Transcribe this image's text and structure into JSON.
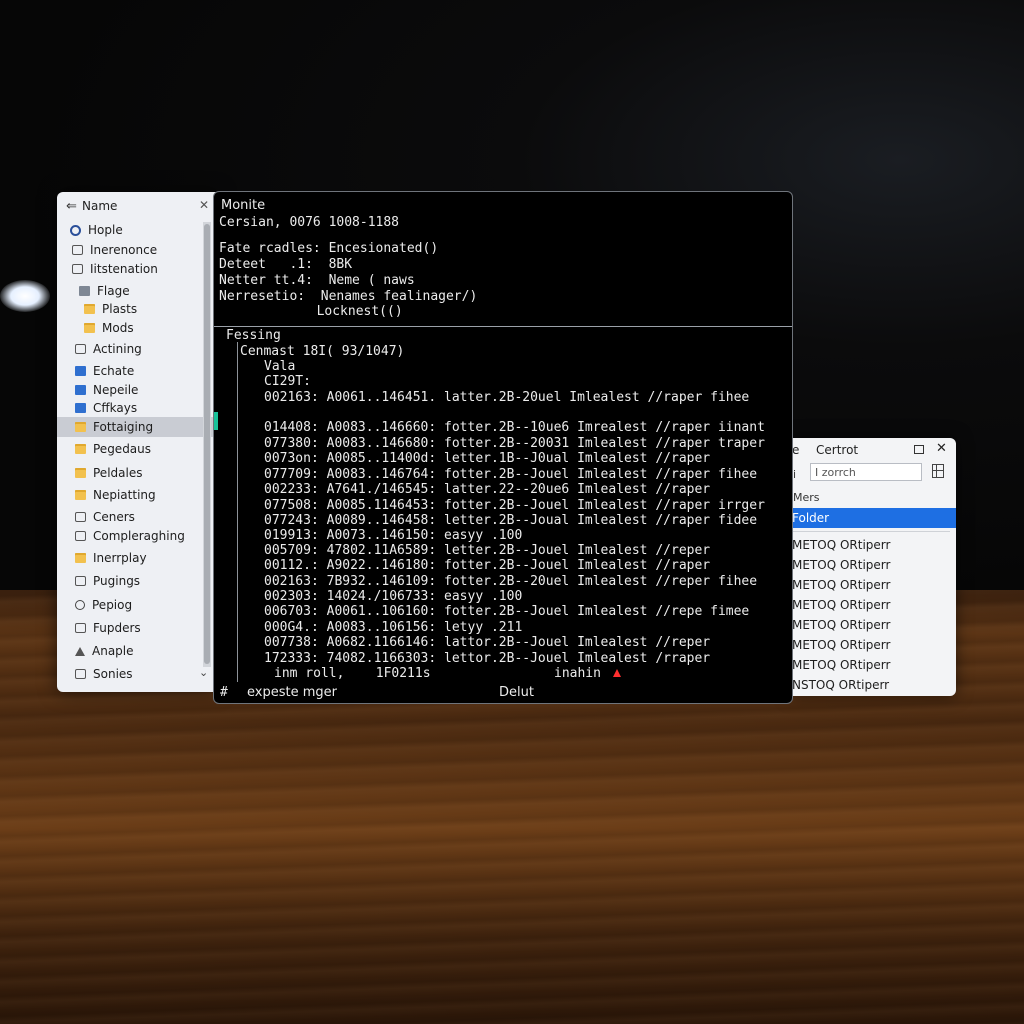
{
  "file_panel": {
    "header": "Name",
    "items": [
      {
        "label": "Hople",
        "icon": "search-icon"
      },
      {
        "label": "Inerenonce",
        "icon": "document-icon"
      },
      {
        "label": "Iitstenation",
        "icon": "document-icon"
      },
      {
        "label": "Flage",
        "icon": "document-icon"
      },
      {
        "label": "Plasts",
        "icon": "folder-icon"
      },
      {
        "label": "Mods",
        "icon": "folder-icon"
      },
      {
        "label": "Actining",
        "icon": "document-icon"
      },
      {
        "label": "Echate",
        "icon": "app-icon"
      },
      {
        "label": "Nepeile",
        "icon": "app-icon"
      },
      {
        "label": "Cffkays",
        "icon": "app-icon"
      },
      {
        "label": "Fottaiging",
        "icon": "folder-icon"
      },
      {
        "label": "Pegedaus",
        "icon": "folder-icon"
      },
      {
        "label": "Peldales",
        "icon": "folder-icon"
      },
      {
        "label": "Nepiatting",
        "icon": "folder-icon"
      },
      {
        "label": "Ceners",
        "icon": "document-icon"
      },
      {
        "label": "Compleraghing",
        "icon": "document-icon"
      },
      {
        "label": "Inerrplay",
        "icon": "folder-icon"
      },
      {
        "label": "Pugings",
        "icon": "document-icon"
      },
      {
        "label": "Pepiog",
        "icon": "disc-icon"
      },
      {
        "label": "Fupders",
        "icon": "document-icon"
      },
      {
        "label": "Anaple",
        "icon": "triangle-icon"
      },
      {
        "label": "Sonies",
        "icon": "document-icon"
      }
    ],
    "selected_index": 10
  },
  "terminal": {
    "title": "Monite",
    "version": "Cersian, 0076 1008-1188",
    "info": [
      "Fate rcadles: Encesionated()",
      "Deteet   .1:  8BK",
      "Netter tt.4:  Neme ( naws",
      "Nerresetio:  Nenames fealinager/)",
      "              Locknest(()"
    ],
    "section_label": "Fessing",
    "command_header": "Cenmast 18I( 93/1047)",
    "sub_header_1": "Vala",
    "sub_header_2": "CI29T:",
    "log_lines": [
      "002163: A0061..146451. latter.2B-20uel Imlealest //raper fihee",
      "",
      "014408: A0083..146660: fotter.2B--10ue6 Imrealest //raper iinant",
      "077380: A0083..146680: fotter.2B--20031 Imlealest //raper traper",
      "0073on: A0085..11400d: letter.1B--J0ual Imlealest //raper",
      "077709: A0083..146764: fotter.2B--Jouel Imlealest //raper fihee",
      "002233: A7641./146545: latter.22--20ue6 Imlealest //raper",
      "077508: A0085.1146453: fotter.2B--Jouel Imlealest //raper irrger",
      "077243: A0089..146458: letter.2B--Joual Imlealest //raper fidee",
      "019913: A0073..146150: easyy .100",
      "005709: 47802.11A6589: letter.2B--Jouel Imlealest //reper",
      "00112.: A9022..146180: fotter.2B--Jouel Imlealest //raper",
      "002163: 7B932..146109: fotter.2B--20uel Imlealest //reper fihee",
      "002303: 14024./106733: easyy .100",
      "006703: A0061..106160: fotter.2B--Jouel Imlealest //repe fimee",
      "000G4.: A0083..106156: letyy .211",
      "007738: A0682.1166146: lattor.2B--Jouel Imlealest //reper",
      "172333: 74082.1166303: lettor.2B--Jouel Imlealest /rraper"
    ],
    "last_line_left": "inm roll,    1F0211s",
    "last_line_right": "inahin",
    "prompt_symbol": "#",
    "status_left": "expeste mger",
    "status_right": "Delut",
    "warning_color": "#ff2f2f",
    "accent_color": "#19c29a"
  },
  "finder_panel": {
    "title_prefix": "e",
    "title": "Certrot",
    "search_prefix": "i",
    "search_placeholder": "I zorrch",
    "column_header": "Mers",
    "selected_item": "Folder",
    "rows": [
      "METOQ ORtiperr",
      "METOQ ORtiperr",
      "METOQ ORtiperr",
      "METOQ ORtiperr",
      "METOQ ORtiperr",
      "METOQ ORtiperr",
      "METOQ ORtiperr",
      "NSTOQ ORtiperr"
    ],
    "accent_color": "#1e6fe3"
  }
}
